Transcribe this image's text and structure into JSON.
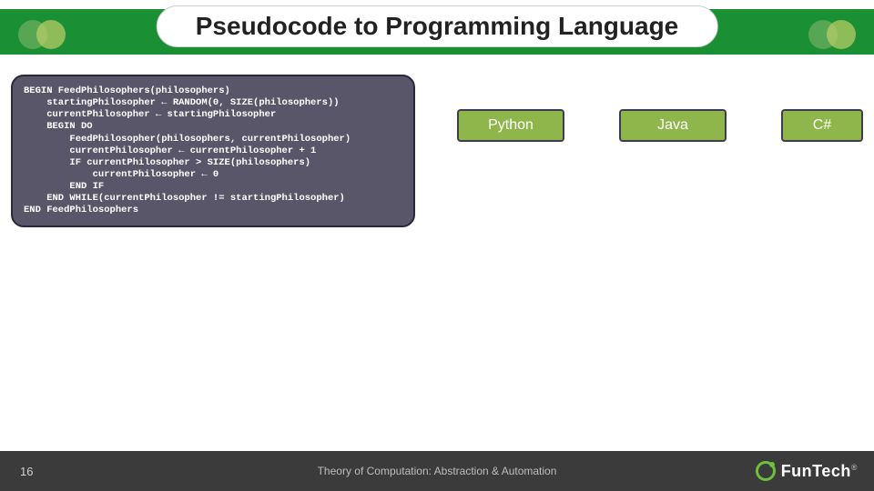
{
  "title": "Pseudocode to Programming Language",
  "code": "BEGIN FeedPhilosophers(philosophers)\n    startingPhilosopher ← RANDOM(0, SIZE(philosophers))\n    currentPhilosopher ← startingPhilosopher\n    BEGIN DO\n        FeedPhilosopher(philosophers, currentPhilosopher)\n        currentPhilosopher ← currentPhilosopher + 1\n        IF currentPhilosopher > SIZE(philosophers)\n            currentPhilosopher ← 0\n        END IF\n    END WHILE(currentPhilosopher != startingPhilosopher)\nEND FeedPhilosophers",
  "languages": {
    "python": "Python",
    "java": "Java",
    "cs": "C#"
  },
  "footer": {
    "slide_no": "16",
    "text": "Theory of Computation: Abstraction & Automation",
    "brand": "FunTech",
    "reg": "®"
  }
}
